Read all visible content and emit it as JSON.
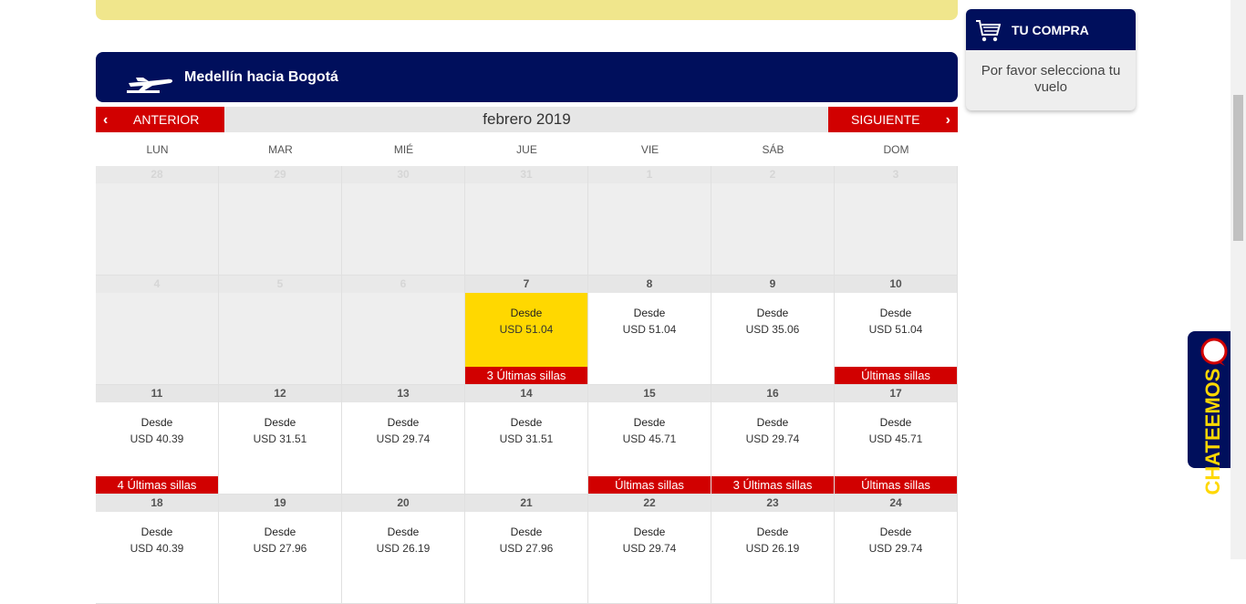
{
  "route": {
    "title": "Medellín hacia Bogotá",
    "icon": "plane-icon"
  },
  "calendar": {
    "month_title": "febrero 2019",
    "prev_label": "ANTERIOR",
    "next_label": "SIGUIENTE",
    "weekdays": [
      "LUN",
      "MAR",
      "MIÉ",
      "JUE",
      "VIE",
      "SÁB",
      "DOM"
    ],
    "desde_label": "Desde",
    "weeks": [
      [
        {
          "day": "28",
          "active": false
        },
        {
          "day": "29",
          "active": false
        },
        {
          "day": "30",
          "active": false
        },
        {
          "day": "31",
          "active": false
        },
        {
          "day": "1",
          "active": false
        },
        {
          "day": "2",
          "active": false
        },
        {
          "day": "3",
          "active": false
        }
      ],
      [
        {
          "day": "4",
          "active": false
        },
        {
          "day": "5",
          "active": false
        },
        {
          "day": "6",
          "active": false
        },
        {
          "day": "7",
          "active": true,
          "selected": true,
          "price": "USD 51.04",
          "badge": "3 Últimas sillas"
        },
        {
          "day": "8",
          "active": true,
          "price": "USD 51.04"
        },
        {
          "day": "9",
          "active": true,
          "price": "USD 35.06"
        },
        {
          "day": "10",
          "active": true,
          "price": "USD 51.04",
          "badge": "Últimas sillas"
        }
      ],
      [
        {
          "day": "11",
          "active": true,
          "price": "USD 40.39",
          "badge": "4 Últimas sillas"
        },
        {
          "day": "12",
          "active": true,
          "price": "USD 31.51"
        },
        {
          "day": "13",
          "active": true,
          "price": "USD 29.74"
        },
        {
          "day": "14",
          "active": true,
          "price": "USD 31.51"
        },
        {
          "day": "15",
          "active": true,
          "price": "USD 45.71",
          "badge": "Últimas sillas"
        },
        {
          "day": "16",
          "active": true,
          "price": "USD 29.74",
          "badge": "3 Últimas sillas"
        },
        {
          "day": "17",
          "active": true,
          "price": "USD 45.71",
          "badge": "Últimas sillas"
        }
      ],
      [
        {
          "day": "18",
          "active": true,
          "price": "USD 40.39"
        },
        {
          "day": "19",
          "active": true,
          "price": "USD 27.96"
        },
        {
          "day": "20",
          "active": true,
          "price": "USD 26.19"
        },
        {
          "day": "21",
          "active": true,
          "price": "USD 27.96"
        },
        {
          "day": "22",
          "active": true,
          "price": "USD 29.74"
        },
        {
          "day": "23",
          "active": true,
          "price": "USD 26.19"
        },
        {
          "day": "24",
          "active": true,
          "price": "USD 29.74"
        }
      ]
    ]
  },
  "cart": {
    "title": "TU COMPRA",
    "message": "Por favor selecciona tu vuelo",
    "icon": "cart-icon"
  },
  "chat": {
    "label": "CHATEEMOS",
    "icon": "chat-bubble-icon"
  },
  "colors": {
    "navy": "#000f5c",
    "red": "#d10000",
    "selected": "#ffd800",
    "banner": "#f0e68c"
  }
}
